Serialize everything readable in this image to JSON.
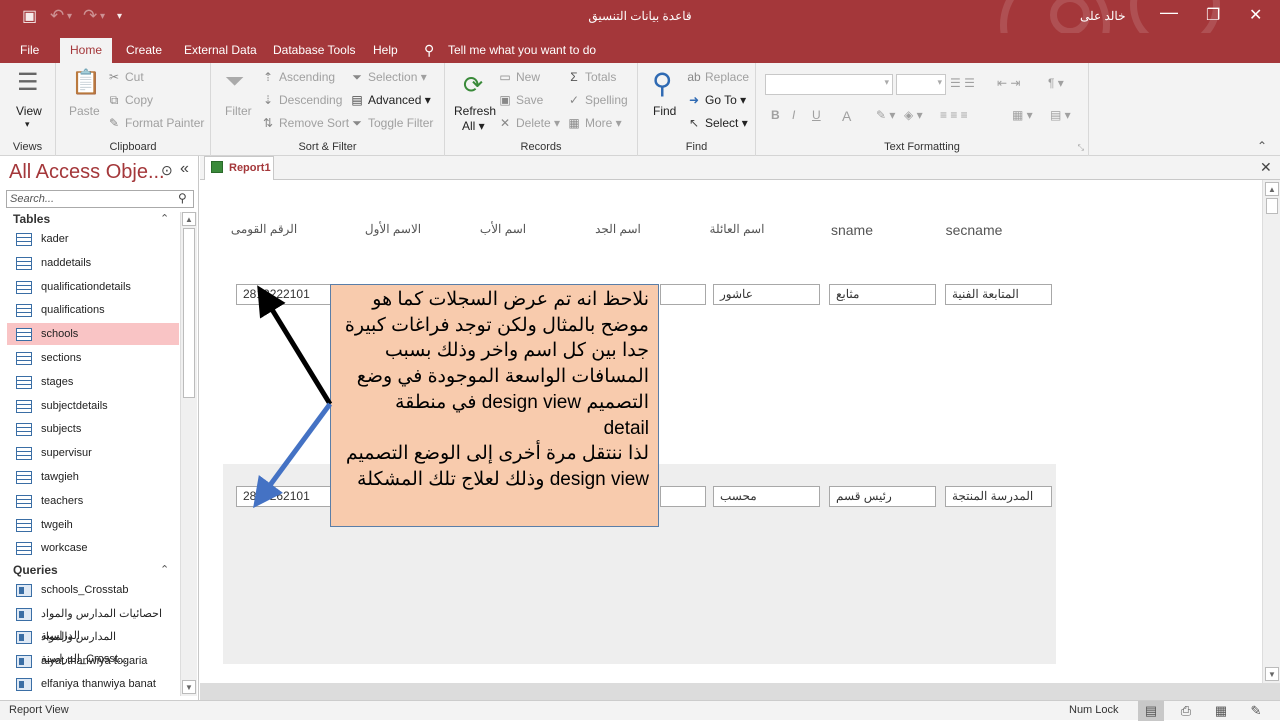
{
  "titlebar": {
    "title": "قاعدة بيانات التنسيق",
    "user": "خالد على",
    "save_icon": "floppy-disk",
    "customize": "▾"
  },
  "tabs": [
    {
      "label": "File"
    },
    {
      "label": "Home"
    },
    {
      "label": "Create"
    },
    {
      "label": "External Data"
    },
    {
      "label": "Database Tools"
    },
    {
      "label": "Help"
    }
  ],
  "tell_me": "Tell me what you want to do",
  "ribbon": {
    "views": {
      "view": "View",
      "group": "Views"
    },
    "clipboard": {
      "paste": "Paste",
      "cut": "Cut",
      "copy": "Copy",
      "format_painter": "Format Painter",
      "group": "Clipboard"
    },
    "sort_filter": {
      "filter": "Filter",
      "ascending": "Ascending",
      "descending": "Descending",
      "remove_sort": "Remove Sort",
      "selection": "Selection",
      "advanced": "Advanced",
      "toggle_filter": "Toggle Filter",
      "group": "Sort & Filter"
    },
    "records": {
      "refresh": "Refresh",
      "refresh_all": "All",
      "new": "New",
      "save": "Save",
      "delete": "Delete",
      "totals": "Totals",
      "spelling": "Spelling",
      "more": "More",
      "group": "Records"
    },
    "find": {
      "find": "Find",
      "replace": "Replace",
      "goto": "Go To",
      "select": "Select",
      "group": "Find"
    },
    "text_formatting": {
      "bold": "B",
      "italic": "I",
      "underline": "U",
      "font_color": "A",
      "group": "Text Formatting"
    }
  },
  "nav": {
    "title": "All Access Obje...",
    "search_placeholder": "Search...",
    "tables_label": "Tables",
    "queries_label": "Queries",
    "tables": [
      "kader",
      "naddetails",
      "qualificationdetails",
      "qualifications",
      "schools",
      "sections",
      "stages",
      "subjectdetails",
      "subjects",
      "supervisur",
      "tawgieh",
      "teachers",
      "twgeih",
      "workcase"
    ],
    "queries": [
      "schools_Crosstab",
      "احصائيات المدارس والمواد الدراسية",
      "المدارس والمواد الدراسية_Crosst...",
      "aiyat thanwiya togaria",
      "elfaniya thanwiya banat"
    ]
  },
  "doc_tab": "Report1",
  "report": {
    "headers": [
      "الرقم القومى",
      "الاسم الأول",
      "اسم الأب",
      "اسم الجد",
      "اسم العائلة",
      "sname",
      "secname"
    ],
    "row1": {
      "id": "2812222101",
      "family": "عاشور",
      "sname": "مثابع",
      "secname": "المتابعة الفنية"
    },
    "row2": {
      "id": "2809262101",
      "family": "محسب",
      "sname": "رئيس قسم",
      "secname": "المدرسة المنتجة"
    }
  },
  "callout": {
    "lines": [
      "نلاحظ انه تم عرض السجلات كما هو",
      "موضح بالمثال ولكن توجد فراغات كبيرة",
      "جدا بين كل اسم واخر وذلك بسبب",
      "المسافات الواسعة الموجودة في وضع",
      "التصميم design view في منطقة",
      "detail",
      "لذا ننتقل مرة أخرى إلى الوضع التصميم",
      "design view وذلك لعلاج تلك المشكلة"
    ]
  },
  "status": {
    "left": "Report View",
    "num_lock": "Num Lock"
  },
  "colors": {
    "accent": "#a4373a",
    "callout_fill": "#f8cbad",
    "arrow_black": "#000000",
    "arrow_blue": "#4472c4",
    "selected_item": "#f9c4c5"
  }
}
